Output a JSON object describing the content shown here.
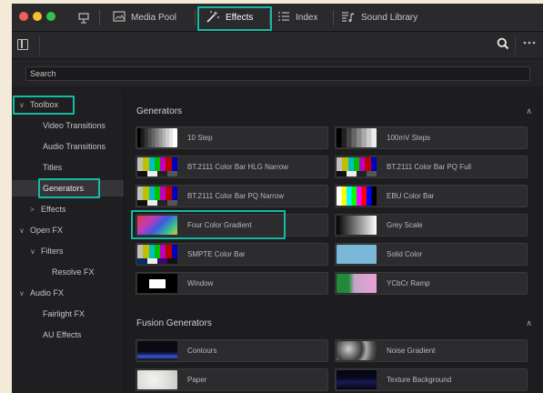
{
  "window": {
    "dots": [
      "#ee5f56",
      "#f7bd33",
      "#2fc54a"
    ]
  },
  "toolbar": {
    "tabs": [
      {
        "label": "Media Pool",
        "icon": "image-icon"
      },
      {
        "label": "Effects",
        "icon": "magic-wand-icon"
      },
      {
        "label": "Index",
        "icon": "list-icon"
      },
      {
        "label": "Sound Library",
        "icon": "music-list-icon"
      }
    ]
  },
  "search": {
    "value": "Search"
  },
  "sidebar": {
    "items": [
      {
        "label": "Toolbox",
        "chevron": "∨"
      },
      {
        "label": "Video Transitions"
      },
      {
        "label": "Audio Transitions"
      },
      {
        "label": "Titles"
      },
      {
        "label": "Generators"
      },
      {
        "label": "Effects",
        "chevron": ">"
      },
      {
        "label": "Open FX",
        "chevron": "∨"
      },
      {
        "label": "Filters",
        "chevron": "∨"
      },
      {
        "label": "Resolve FX"
      },
      {
        "label": "Audio FX",
        "chevron": "∨"
      },
      {
        "label": "Fairlight FX"
      },
      {
        "label": "AU Effects"
      }
    ]
  },
  "sections": {
    "generators": {
      "title": "Generators",
      "tiles": [
        {
          "label": "10 Step",
          "thumb": "step"
        },
        {
          "label": "100mV Steps",
          "thumb": "step"
        },
        {
          "label": "BT.2111 Color Bar HLG Narrow",
          "thumb": "colorbar"
        },
        {
          "label": "BT.2111 Color Bar PQ Full",
          "thumb": "colorbar"
        },
        {
          "label": "BT.2111 Color Bar PQ Narrow",
          "thumb": "colorbar"
        },
        {
          "label": "EBU Color Bar",
          "thumb": "ebu"
        },
        {
          "label": "Four Color Gradient",
          "thumb": "fourcolor"
        },
        {
          "label": "Grey Scale",
          "thumb": "grey"
        },
        {
          "label": "SMPTE Color Bar",
          "thumb": "colorbar"
        },
        {
          "label": "Solid Color",
          "thumb": "solid"
        },
        {
          "label": "Window",
          "thumb": "window"
        },
        {
          "label": "YCbCr Ramp",
          "thumb": "ycbcr"
        }
      ]
    },
    "fusion": {
      "title": "Fusion Generators",
      "tiles": [
        {
          "label": "Contours",
          "thumb": "contours"
        },
        {
          "label": "Noise Gradient",
          "thumb": "noise"
        },
        {
          "label": "Paper",
          "thumb": "paper"
        },
        {
          "label": "Texture Background",
          "thumb": "texture"
        }
      ]
    }
  }
}
